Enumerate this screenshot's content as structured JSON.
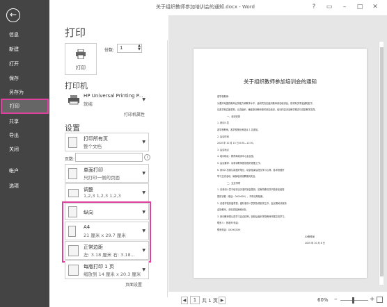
{
  "window": {
    "title": "关于组织教师参加培训会的通知.docx - Word",
    "help": "?",
    "restore": "▭",
    "minimize": "–",
    "maximize": "□",
    "close": "✕"
  },
  "sidebar": {
    "back_glyph": "←",
    "items": [
      {
        "label": "信息"
      },
      {
        "label": "新建"
      },
      {
        "label": "打开"
      },
      {
        "label": "保存"
      },
      {
        "label": "另存为"
      },
      {
        "label": "打印"
      },
      {
        "label": "共享"
      },
      {
        "label": "导出"
      },
      {
        "label": "关闭"
      },
      {
        "label": "帐户"
      },
      {
        "label": "选项"
      }
    ],
    "active_index": 5
  },
  "print": {
    "heading": "打印",
    "button_label": "打印",
    "copies_label": "份数:",
    "copies_value": "1"
  },
  "printer": {
    "heading": "打印机",
    "name": "HP Universal Printing P...",
    "status": "就绪",
    "properties_link": "打印机属性"
  },
  "settings": {
    "heading": "设置",
    "print_range": {
      "title": "打印所有页",
      "subtitle": "整个文档"
    },
    "pages_label": "页数:",
    "pages_value": "",
    "sides": {
      "title": "单面打印",
      "subtitle": "只打印一侧的页面"
    },
    "collate": {
      "title": "调整",
      "subtitle": "1,2,3    1,2,3    1,2,3"
    },
    "orientation": {
      "title": "纵向",
      "subtitle": ""
    },
    "paper": {
      "title": "A4",
      "subtitle": "21 厘米 x 29.7 厘米"
    },
    "margins": {
      "title": "正常边距",
      "subtitle": "左: 3.18 厘米    右: 3.18..."
    },
    "per_sheet": {
      "title": "每版打印 1 页",
      "subtitle": "缩放到 14 厘米 x 20.3 厘米"
    },
    "page_setup_link": "页面设置"
  },
  "preview": {
    "doc_title": "关于组织教师参加培训会的通知",
    "lines": [
      "各学校教师：",
      "为更好地提高教师业务能力和教学水平，经研究决定组织教师参加培训会，现将有关事宜通知如下，",
      "请各学校高度重视，认真组织，确保参训教师按时参加培训，培训内容涉及教学理念与课堂教学实践。",
      "一、培训安排",
      "1. 参训人员",
      "各学校教师。各学校按比例选派 1 名参加。",
      "2. 会议时间",
      "2020 年 10 月 15 日 8:30—11:30。",
      "3. 会议地点",
      "4. 培训地址：教育局培训中心会议室。",
      "5. 会议要求：请参训教师提前做好准备工作。",
      "6. 参训人员需认真做好笔记，培训结束后提交学习心得，各学校做好",
      "学习交流活动，确保培训效果落到实处。",
      "二、注意事项",
      "1. 请参训人员于培训当天准时到会签到，如有特殊情况不能参加者需",
      "提前请假（电话：0000000），不得无故缺席。",
      "2. 请各学校高度重视，做好参训人员的协调安排工作，会议期间请保持",
      "会场秩序，手机调至静音状态。",
      "3. 参训教师需认真学习会议精神，回校后组织学校教师开展交流学习。",
      "联系人：张老师    电话：",
      "联系电话：XXXXXXXX",
      "XX教育局",
      "2020 年 10 月 8 日"
    ],
    "page_current": "1",
    "page_total_label": "共 1 页",
    "zoom": "60%"
  }
}
